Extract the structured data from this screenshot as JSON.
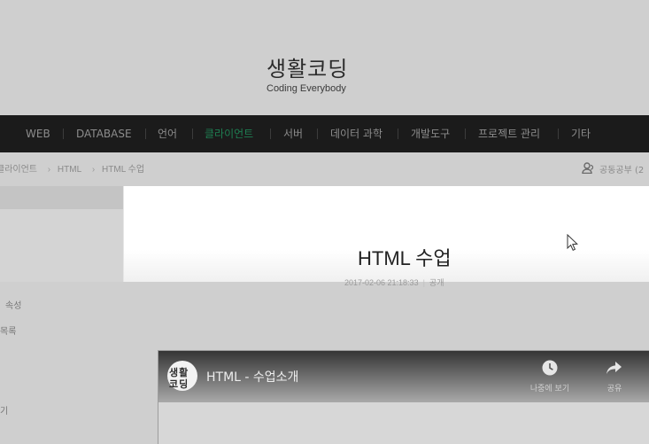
{
  "site": {
    "title": "생활코딩",
    "subtitle": "Coding Everybody"
  },
  "nav": {
    "items": [
      "WEB",
      "DATABASE",
      "언어",
      "클라이언트",
      "서버",
      "데이터 과학",
      "개발도구",
      "프로젝트 관리",
      "기타"
    ],
    "active": "클라이언트"
  },
  "breadcrumb": {
    "items": [
      "클라이언트",
      "HTML",
      "HTML 수업"
    ]
  },
  "user": {
    "label": "공동공부 (2"
  },
  "post": {
    "title": "HTML 수업",
    "date": "2017-02-06 21:18:33",
    "visibility": "공개"
  },
  "sidebar": {
    "links": [
      "속성",
      "목록",
      "기"
    ]
  },
  "video": {
    "channel_logo_line1": "생활",
    "channel_logo_line2": "코딩",
    "title": "HTML - 수업소개",
    "watch_later": "나중에 보기",
    "share": "공유"
  },
  "colors": {
    "nav_bg": "#1b1b1b",
    "nav_active": "#1e7f52",
    "page_bg": "#cfcfcf"
  }
}
